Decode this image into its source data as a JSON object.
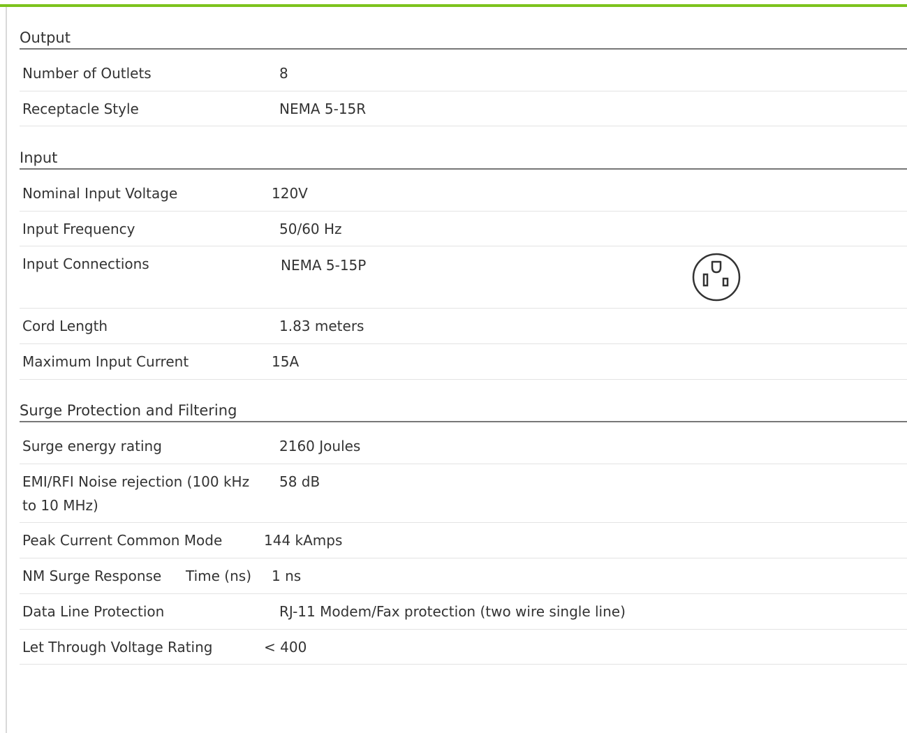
{
  "sections": {
    "output": {
      "title": "Output",
      "rows": [
        {
          "label": "Number of Outlets",
          "value": "8"
        },
        {
          "label": "Receptacle Style",
          "value": "NEMA 5-15R"
        }
      ]
    },
    "input": {
      "title": "Input",
      "rows": [
        {
          "label": "Nominal Input Voltage",
          "value": "120V"
        },
        {
          "label": "Input Frequency",
          "value": "50/60 Hz"
        },
        {
          "label": "Input Connections",
          "value": "NEMA 5-15P",
          "icon": "nema-5-15-outlet-icon"
        },
        {
          "label": "Cord Length",
          "value": "1.83 meters"
        },
        {
          "label": "Maximum Input Current",
          "value": "15A"
        }
      ]
    },
    "surge": {
      "title": "Surge Protection and Filtering",
      "rows": [
        {
          "label": "Surge energy rating",
          "value": "2160 Joules"
        },
        {
          "label": "EMI/RFI Noise rejection (100 kHz to 10 MHz)",
          "value": "58 dB"
        },
        {
          "label": "Peak Current Common Mode",
          "value": "144 kAmps"
        },
        {
          "label": "NM Surge Response",
          "label_extra": "Time (ns)",
          "value": "1 ns"
        },
        {
          "label": "Data Line Protection",
          "value": "RJ-11 Modem/Fax protection (two wire single line)"
        },
        {
          "label": "Let Through Voltage Rating",
          "value": "< 400"
        }
      ]
    }
  },
  "colors": {
    "accent": "#7dc31d",
    "text": "#333333",
    "divider": "#e3e3e3",
    "section_rule": "#777777"
  }
}
